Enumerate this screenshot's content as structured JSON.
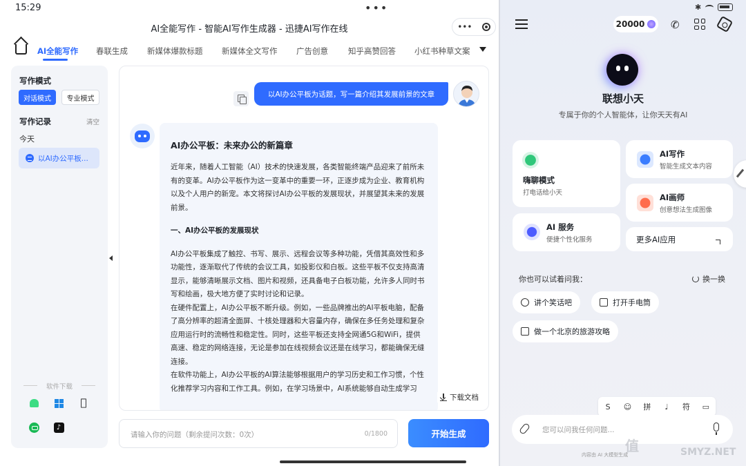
{
  "status": {
    "time": "15:29"
  },
  "left_app": {
    "title": "AI全能写作 - 智能AI写作生成器 - 迅捷AI写作在线",
    "title_menu_glyph": "•••",
    "tabs": [
      "AI全能写作",
      "春联生成",
      "新媒体爆款标题",
      "新媒体全文写作",
      "广告创意",
      "知乎高赞回答",
      "小红书种草文案"
    ],
    "sidebar": {
      "mode_heading": "写作模式",
      "mode_chat": "对话模式",
      "mode_pro": "专业模式",
      "records_heading": "写作记录",
      "clear": "清空",
      "today": "今天",
      "record_item": "以AI办公平板...",
      "download_heading": "软件下载"
    },
    "chat": {
      "user_message": "以AI办公平板为话题，写一篇介绍其发展前景的文章",
      "answer_title": "AI办公平板：未来办公的新篇章",
      "answer_p1": "近年来，随着人工智能（AI）技术的快速发展，各类智能终端产品迎来了前所未有的变革。AI办公平板作为这一变革中的重要一环，正逐步成为企业、教育机构以及个人用户的新宠。本文将探讨AI办公平板的发展现状，并展望其未来的发展前景。",
      "answer_h1": "一、AI办公平板的发展现状",
      "answer_p2": "AI办公平板集成了触控、书写、展示、远程会议等多种功能，凭借其高效性和多功能性，逐渐取代了传统的会议工具，如投影仪和白板。这些平板不仅支持高清显示，能够清晰展示文档、图片和视频，还具备电子白板功能，允许多人同时书写和绘画，极大地方便了实时讨论和记录。",
      "answer_p3": "在硬件配置上，AI办公平板不断升级。例如，一些品牌推出的AI平板电脑，配备了高分辨率的超清全面屏、十核处理器和大容量内存，确保在多任务处理和复杂应用运行时的流畅性和稳定性。同时，这些平板还支持全网通5G和WiFi，提供高速、稳定的网络连接，无论是参加在线视频会议还是在线学习，都能确保无缝连接。",
      "answer_p4": "在软件功能上，AI办公平板的AI算法能够根据用户的学习历史和工作习惯，个性化推荐学习内容和工作工具。例如，在学习场景中，AI系统能够自动生成学习",
      "download_doc": "下载文档"
    },
    "input": {
      "placeholder": "请输入你的问题（剩余提问次数：0次）",
      "counter": "0/1800",
      "generate": "开始生成"
    }
  },
  "right_app": {
    "points": "20000",
    "name": "联想小天",
    "subtitle": "专属于你的个人智能体，让你天天有AI",
    "cards": {
      "chat_title": "嗨聊模式",
      "chat_sub": "打电话给小天",
      "write_title": "AI写作",
      "write_sub": "智能生成文本内容",
      "paint_title": "AI画师",
      "paint_sub": "创意想法生成图像",
      "service_title": "AI 服务",
      "service_sub": "便捷个性化服务",
      "more_title": "更多AI应用"
    },
    "try_label": "你也可以试着问我：",
    "refresh": "换一换",
    "chips": [
      "讲个笑话吧",
      "打开手电筒",
      "做一个北京的旅游攻略"
    ],
    "ime_keys": [
      "拼",
      "符"
    ],
    "input_placeholder": "您可以问我任何问题...",
    "footer_note": "内容由 AI 大模型生成",
    "watermark": "值",
    "watermark_sub": "SMYZ.NET"
  }
}
